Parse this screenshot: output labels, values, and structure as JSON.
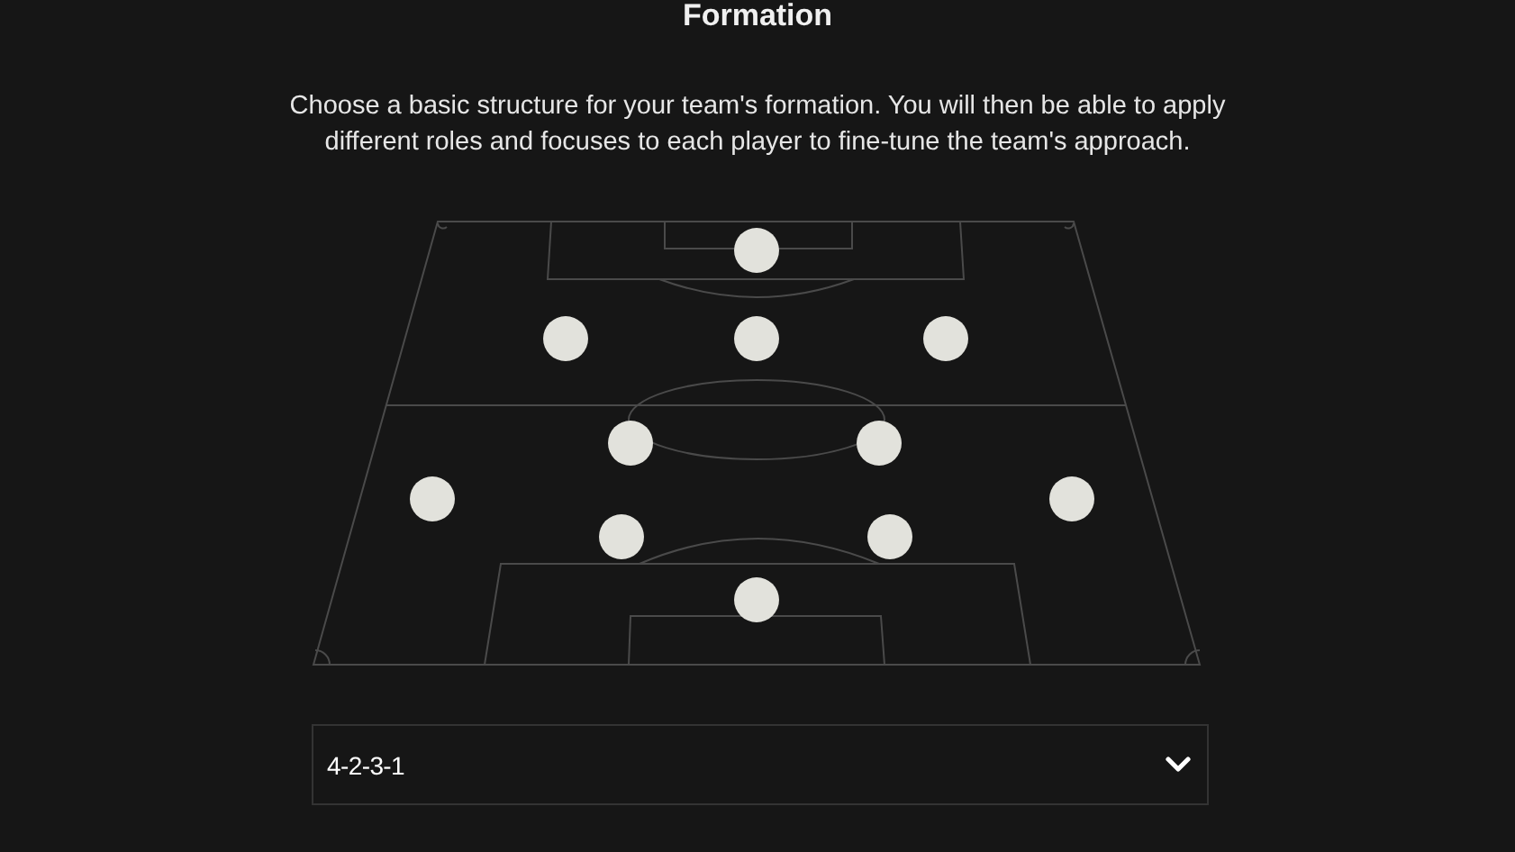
{
  "title": "Formation",
  "description": "Choose a basic structure for your team's formation. You will then be able to apply different roles and focuses to each player to fine-tune the team's approach.",
  "formation_select": {
    "value": "4-2-3-1"
  }
}
